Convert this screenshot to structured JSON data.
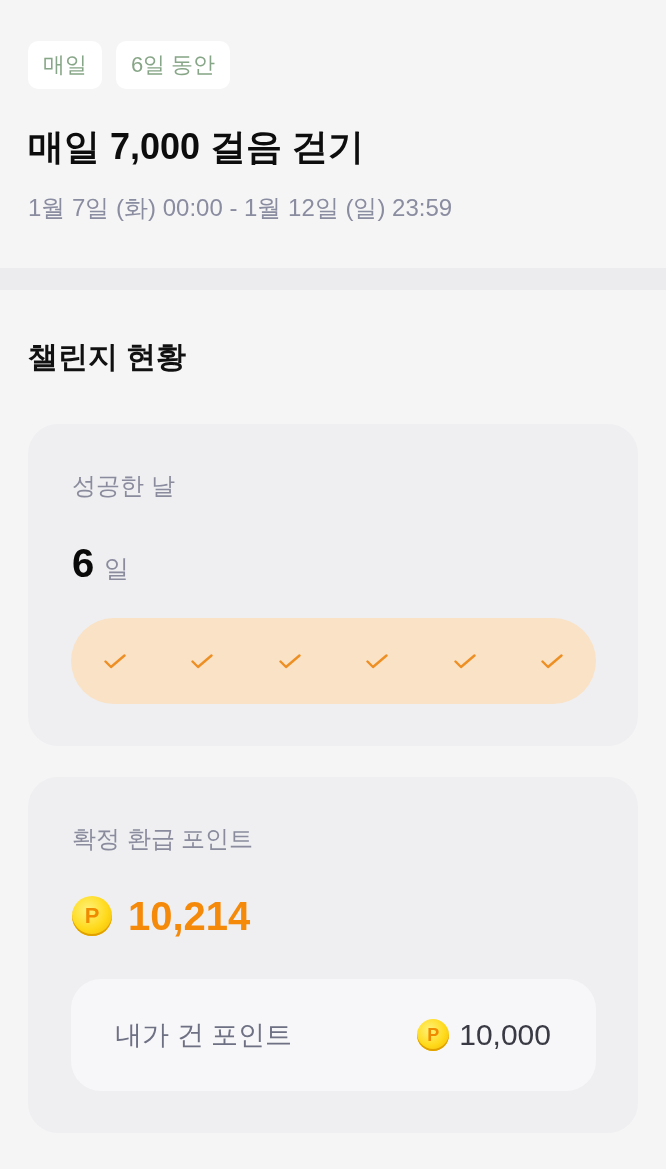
{
  "tags": [
    "매일",
    "6일 동안"
  ],
  "challenge": {
    "title": "매일 7,000 걸음 걷기",
    "period": "1월 7일 (화) 00:00 - 1월 12일 (일) 23:59"
  },
  "status": {
    "heading": "챌린지 현황",
    "success_days": {
      "label": "성공한 날",
      "count": "6",
      "unit": "일",
      "days": [
        {
          "checked": true
        },
        {
          "checked": true
        },
        {
          "checked": true
        },
        {
          "checked": true
        },
        {
          "checked": true
        },
        {
          "checked": true
        }
      ]
    },
    "refund_points": {
      "label": "확정 환급 포인트",
      "coin": "P",
      "amount": "10,214",
      "stake": {
        "label": "내가 건 포인트",
        "coin": "P",
        "amount": "10,000"
      }
    }
  }
}
